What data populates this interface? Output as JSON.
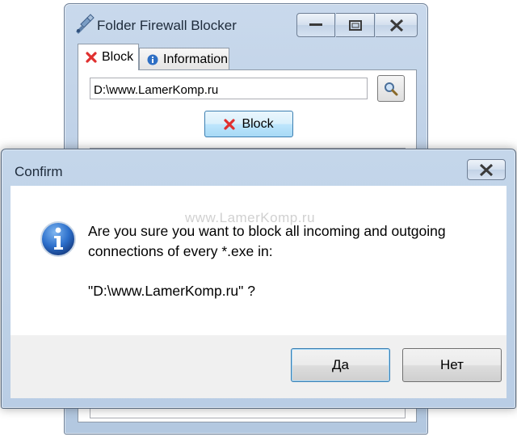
{
  "app": {
    "title": "Folder Firewall Blocker",
    "tabs": [
      {
        "label": "Block",
        "icon": "red-x-icon"
      },
      {
        "label": "Information",
        "icon": "info-icon"
      }
    ],
    "path_value": "D:\\www.LamerKomp.ru",
    "block_button": "Block"
  },
  "dialog": {
    "title": "Confirm",
    "watermark": "www.LamerKomp.ru",
    "message_line1": "Are you sure you want to block all incoming and outgoing",
    "message_line2": "connections of every *.exe in:",
    "message_path": "\"D:\\www.LamerKomp.ru\" ?",
    "yes_label": "Да",
    "no_label": "Нет",
    "icon": "info-icon"
  },
  "colors": {
    "title_bar": "#b9cde5",
    "info_blue": "#1f5fb5",
    "close_red": "#e0302f",
    "focus_border": "#3c7fb1"
  }
}
